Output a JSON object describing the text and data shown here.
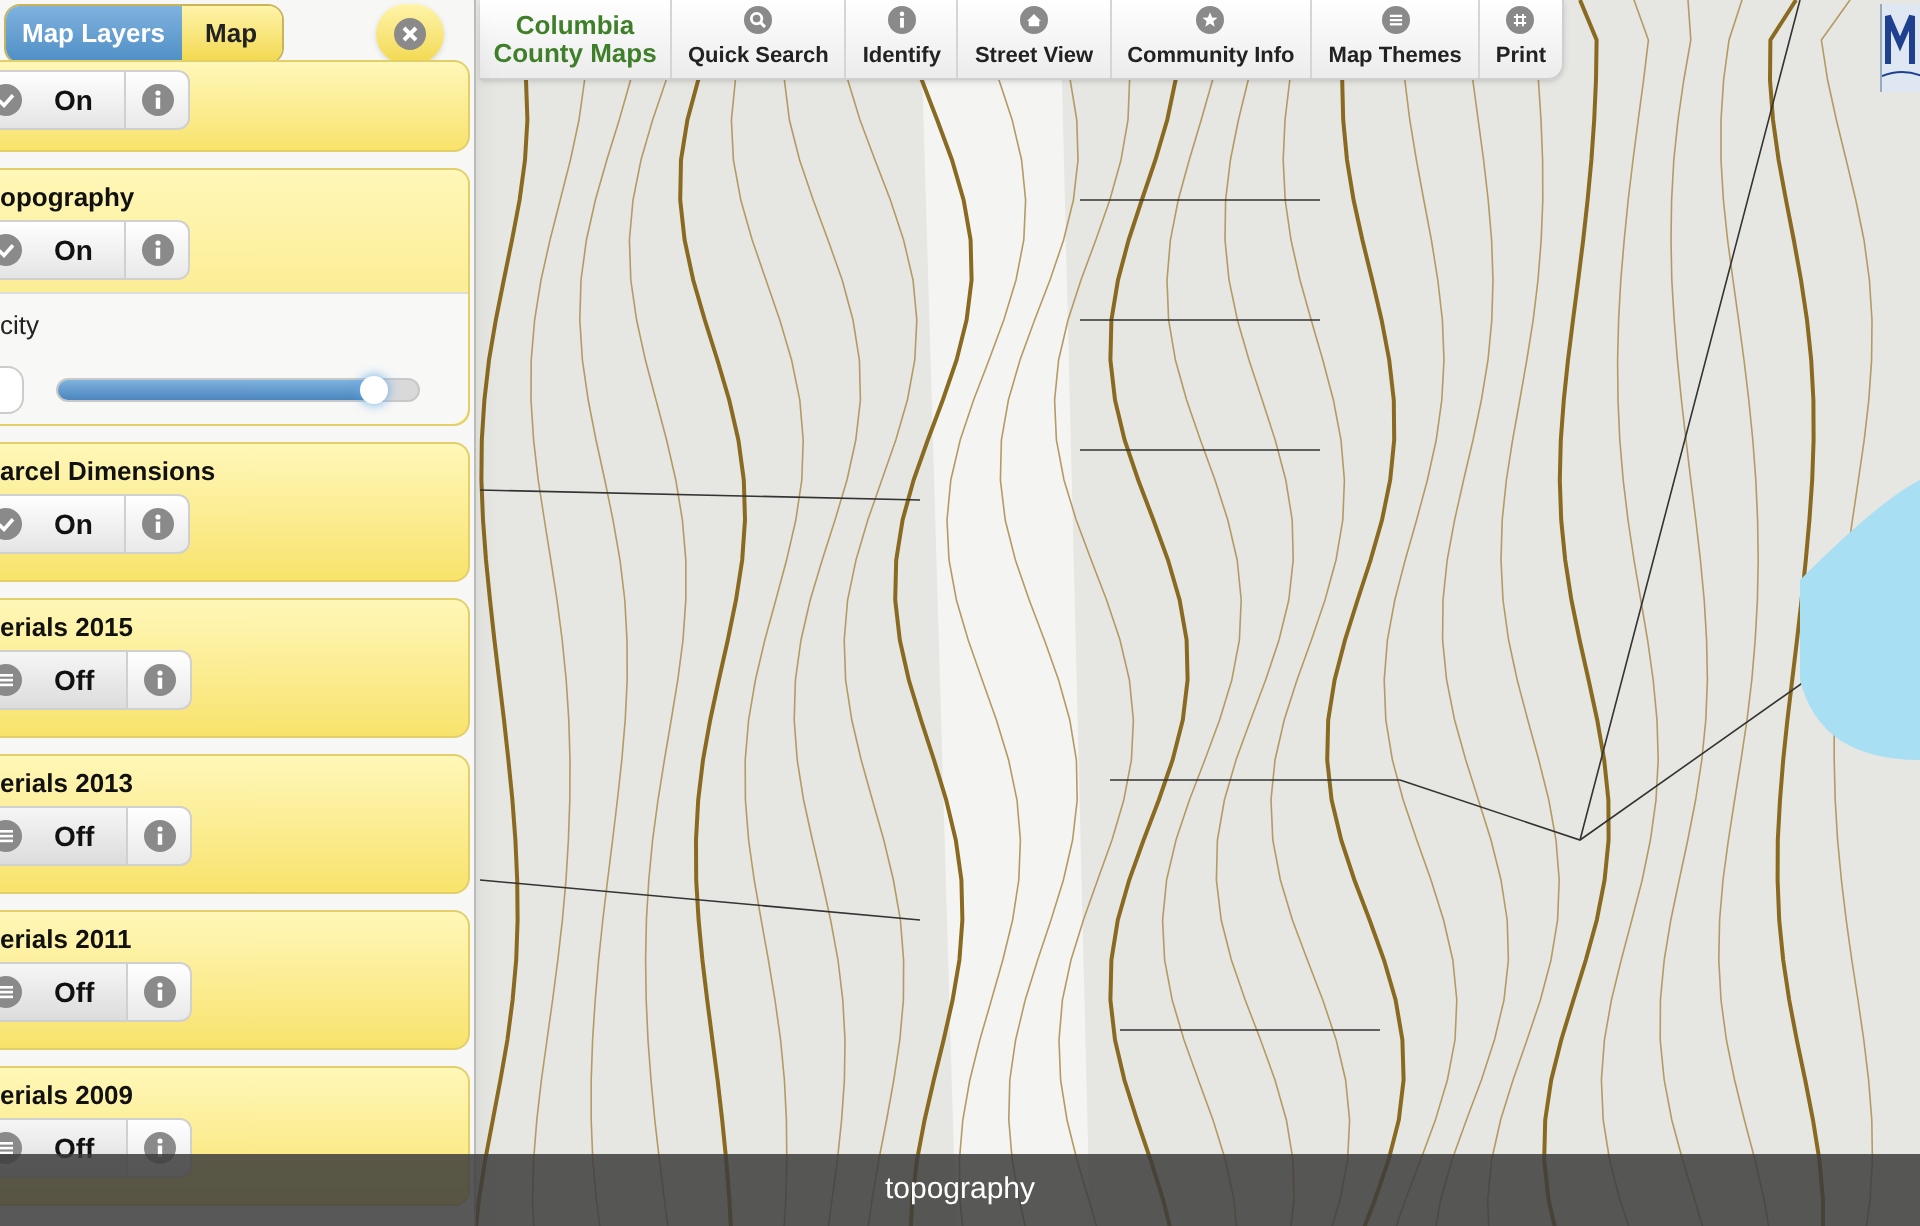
{
  "panel": {
    "tabs": [
      {
        "label": "Map Layers",
        "selected": true
      },
      {
        "label": "Map",
        "selected": false
      }
    ],
    "layers": [
      {
        "kind": "toggle",
        "on": true,
        "label": "On"
      },
      {
        "kind": "toggle",
        "title": "opography",
        "on": true,
        "label": "On",
        "opacity": {
          "label": "city",
          "level": 0.88
        }
      },
      {
        "kind": "toggle",
        "title": "arcel Dimensions",
        "on": true,
        "label": "On"
      },
      {
        "kind": "toggle",
        "title": "erials 2015",
        "on": false,
        "label": "Off"
      },
      {
        "kind": "toggle",
        "title": "erials 2013",
        "on": false,
        "label": "Off"
      },
      {
        "kind": "toggle",
        "title": "erials 2011",
        "on": false,
        "label": "Off"
      },
      {
        "kind": "toggle",
        "title": "erials 2009",
        "on": false,
        "label": "Off"
      }
    ]
  },
  "toolbar": {
    "brand": [
      "Columbia",
      "County Maps"
    ],
    "buttons": [
      {
        "label": "Quick Search"
      },
      {
        "label": "Identify"
      },
      {
        "label": "Street View"
      },
      {
        "label": "Community Info"
      },
      {
        "label": "Map Themes"
      },
      {
        "label": "Print"
      }
    ]
  },
  "caption": "topography"
}
